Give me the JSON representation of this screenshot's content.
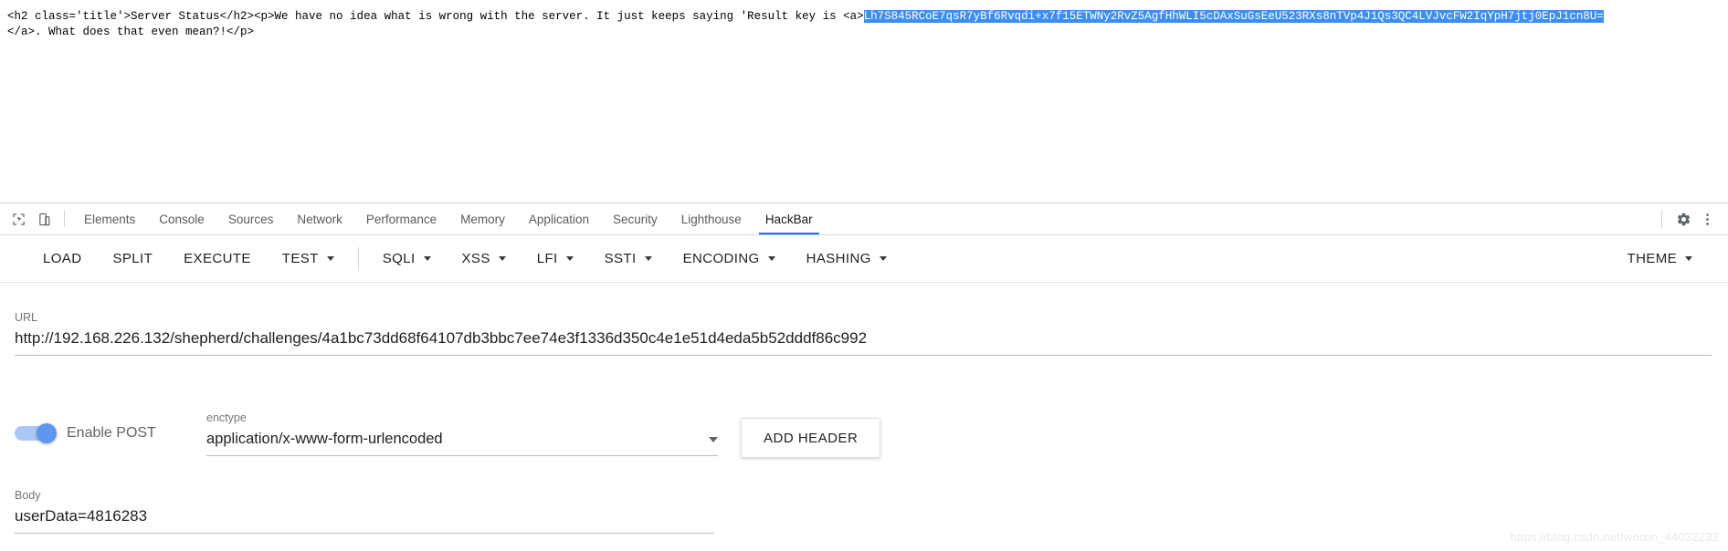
{
  "page_source": {
    "line1_prefix": "<h2 class='title'>Server Status</h2><p>We have no idea what is wrong with the server. It just keeps saying 'Result key is <a>",
    "selected_key": "Lh7S845RCoE7qsR7yBf6Rvqdi+x7f15ETWNy2RvZ5AgfHhWLI5cDAxSuGsEeU523RXs8nTVp4J1Qs3QC4LVJvcFW2IqYpH7jtj0EpJ1cn8U=",
    "line2": "</a>. What does that even mean?!</p>"
  },
  "devtools": {
    "icons": {
      "inspect": "inspect-element-icon",
      "device": "device-toolbar-icon",
      "settings": "gear-icon",
      "more": "kebab-menu-icon"
    },
    "tabs": [
      {
        "label": "Elements",
        "active": false
      },
      {
        "label": "Console",
        "active": false
      },
      {
        "label": "Sources",
        "active": false
      },
      {
        "label": "Network",
        "active": false
      },
      {
        "label": "Performance",
        "active": false
      },
      {
        "label": "Memory",
        "active": false
      },
      {
        "label": "Application",
        "active": false
      },
      {
        "label": "Security",
        "active": false
      },
      {
        "label": "Lighthouse",
        "active": false
      },
      {
        "label": "HackBar",
        "active": true
      }
    ],
    "active_tab": "HackBar",
    "accent_color": "#1a73e8"
  },
  "hackbar": {
    "toolbar": {
      "load": "LOAD",
      "split": "SPLIT",
      "execute": "EXECUTE",
      "test": "TEST",
      "sqli": "SQLI",
      "xss": "XSS",
      "lfi": "LFI",
      "ssti": "SSTI",
      "encoding": "ENCODING",
      "hashing": "HASHING",
      "theme": "THEME"
    },
    "url": {
      "label": "URL",
      "value": "http://192.168.226.132/shepherd/challenges/4a1bc73dd68f64107db3bbc7ee74e3f1336d350c4e1e51d4eda5b52dddf86c992",
      "placeholder": "URL"
    },
    "post": {
      "toggle_label": "Enable POST",
      "enabled": true,
      "toggle_color": "#5d96f0"
    },
    "enctype": {
      "label": "enctype",
      "value": "application/x-www-form-urlencoded"
    },
    "add_header": "ADD HEADER",
    "body": {
      "label": "Body",
      "value": "userData=4816283",
      "placeholder": "Body"
    }
  },
  "watermark": "https://blog.csdn.net/weixin_44032232"
}
